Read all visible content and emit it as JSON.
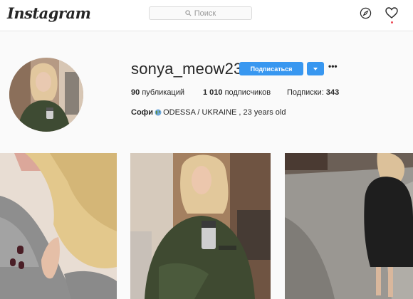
{
  "header": {
    "logo_text": "Instagram",
    "search": {
      "placeholder": "Поиск",
      "icon": "search-icon"
    },
    "icons": [
      "compass-icon",
      "heart-icon"
    ],
    "notification_color": "#ed4956"
  },
  "profile": {
    "username": "sonya_meow23",
    "follow_label": "Подписаться",
    "accent_color": "#3897f0",
    "stats": {
      "posts_count": "90",
      "posts_label": "публикаций",
      "followers_count": "1 010",
      "followers_label": "подписчиков",
      "following_label": "Подписки:",
      "following_count": "343"
    },
    "bio": {
      "name": "Софи",
      "text": "ODESSA / UKRAINE , 23 years old"
    }
  }
}
